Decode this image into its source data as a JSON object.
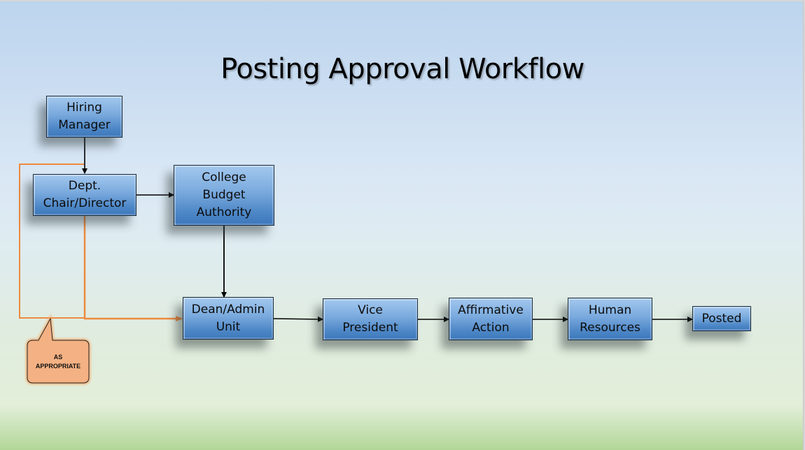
{
  "title": "Posting Approval Workflow",
  "colors": {
    "box_fill_top": "#a3c8ee",
    "box_fill_bottom": "#3d78bb",
    "box_border": "#1e2b3a",
    "orange_path": "#ed8a3f",
    "callout_fill": "#f4b183",
    "connector": "#000000"
  },
  "nodes": [
    {
      "id": "hiring-manager",
      "label": "Hiring\nManager"
    },
    {
      "id": "dept-chair",
      "label": "Dept.\nChair/Director"
    },
    {
      "id": "college-budget",
      "label": "College\nBudget\nAuthority"
    },
    {
      "id": "dean-admin",
      "label": "Dean/Admin\nUnit"
    },
    {
      "id": "vice-president",
      "label": "Vice\nPresident"
    },
    {
      "id": "affirmative-action",
      "label": "Affirmative\nAction"
    },
    {
      "id": "human-resources",
      "label": "Human\nResources"
    },
    {
      "id": "posted",
      "label": "Posted"
    }
  ],
  "edges": [
    {
      "from": "hiring-manager",
      "to": "dept-chair",
      "style": "black"
    },
    {
      "from": "dept-chair",
      "to": "college-budget",
      "style": "black"
    },
    {
      "from": "college-budget",
      "to": "dean-admin",
      "style": "black"
    },
    {
      "from": "dean-admin",
      "to": "vice-president",
      "style": "black"
    },
    {
      "from": "vice-president",
      "to": "affirmative-action",
      "style": "black"
    },
    {
      "from": "affirmative-action",
      "to": "human-resources",
      "style": "black"
    },
    {
      "from": "human-resources",
      "to": "posted",
      "style": "black"
    },
    {
      "from": "dept-chair",
      "to": "dean-admin",
      "style": "orange"
    },
    {
      "from": "hiring-manager",
      "to": "dean-admin",
      "style": "orange"
    }
  ],
  "callout": {
    "label": "AS\nAPPROPRIATE"
  }
}
